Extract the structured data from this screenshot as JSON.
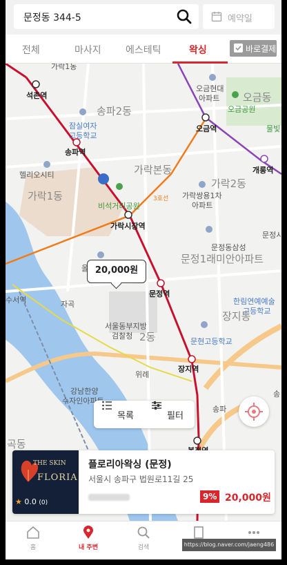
{
  "search": {
    "query": "문정동  344-5"
  },
  "date_picker": {
    "label": "예약일"
  },
  "tabs": [
    {
      "label": "전체"
    },
    {
      "label": "마사지"
    },
    {
      "label": "에스테틱"
    },
    {
      "label": "왁싱"
    }
  ],
  "active_tab": "왁싱",
  "pay_button": {
    "label": "바로결제"
  },
  "map": {
    "labels": {
      "l0": "가락1동",
      "l1": "석촌역",
      "l2": "송파2동",
      "l3": "잠실여자",
      "l4": "고등학교",
      "l5": "송파역",
      "l6": "헬리오시티",
      "l7": "가락1동",
      "l8": "가락본동",
      "l9": "비석거리공원",
      "l10": "가락시장역",
      "l11": "3호선",
      "l12": "가락2동",
      "l13": "가락쌍용1차",
      "l14": "아파트",
      "l15": "오금현대",
      "l16": "아파트",
      "l17": "오금역",
      "l18": "오금동",
      "l19": "오금공원",
      "l20": "개롱역",
      "l21": "물빛",
      "l22": "문정동삼성",
      "l23": "문정1래미안아파트",
      "l24": "문정시",
      "l25": "올림",
      "l26": "문정역",
      "l27": "한림연예예술",
      "l28": "고등학교",
      "l29": "장지동",
      "l30": "서울동부지방",
      "l31": "검찰청",
      "l32": "2동",
      "l33": "문현고등학교",
      "l34": "자곡",
      "l35": "위례",
      "l36": "장지역",
      "l37": "강남한양",
      "l38": "수자인아파트",
      "l39": "송파",
      "l40": "곡동",
      "l41": "복정역",
      "l42": "수서역",
      "l43": "송"
    },
    "line_colors": {
      "line8": "#c8102e",
      "line3": "#ef7c1c",
      "line5": "#7b3fa0",
      "bundang": "#f2c500"
    }
  },
  "price_bubble": "20,000원",
  "list_button": {
    "label": "목록"
  },
  "filter_button": {
    "label": "필터"
  },
  "shop": {
    "name": "플로리아왁싱 (문정)",
    "address": "서울시 송파구 법원로11길 25",
    "rating": "0.0",
    "review_count": "(0)",
    "discount": "9%",
    "price": "20,000원",
    "logo_top": "THE SKIN",
    "logo_main": "FLORIA"
  },
  "nav": [
    {
      "label": "홈"
    },
    {
      "label": "내 주변"
    },
    {
      "label": "검색"
    },
    {
      "label": ""
    },
    {
      "label": ""
    }
  ],
  "active_nav": "내 주변",
  "watermark": "https://blog.naver.com/jaeng486"
}
